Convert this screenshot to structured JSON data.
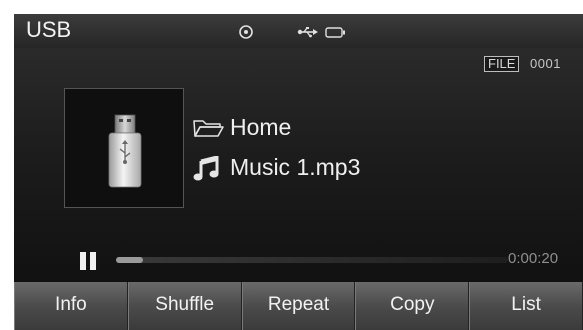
{
  "status": {
    "title": "USB",
    "icons": [
      "disc-icon",
      "usb-icon",
      "battery-icon"
    ]
  },
  "file": {
    "badge": "FILE",
    "number": "0001"
  },
  "album_art": {
    "icon": "usb-drive-icon"
  },
  "now_playing": {
    "folder": "Home",
    "folder_icon": "folder-icon",
    "track": "Music 1.mp3",
    "track_icon": "music-note-icon"
  },
  "playback": {
    "state_icon": "pause-icon",
    "progress": 0.07,
    "time": "0:00:20"
  },
  "softkeys": [
    "Info",
    "Shuffle",
    "Repeat",
    "Copy",
    "List"
  ]
}
